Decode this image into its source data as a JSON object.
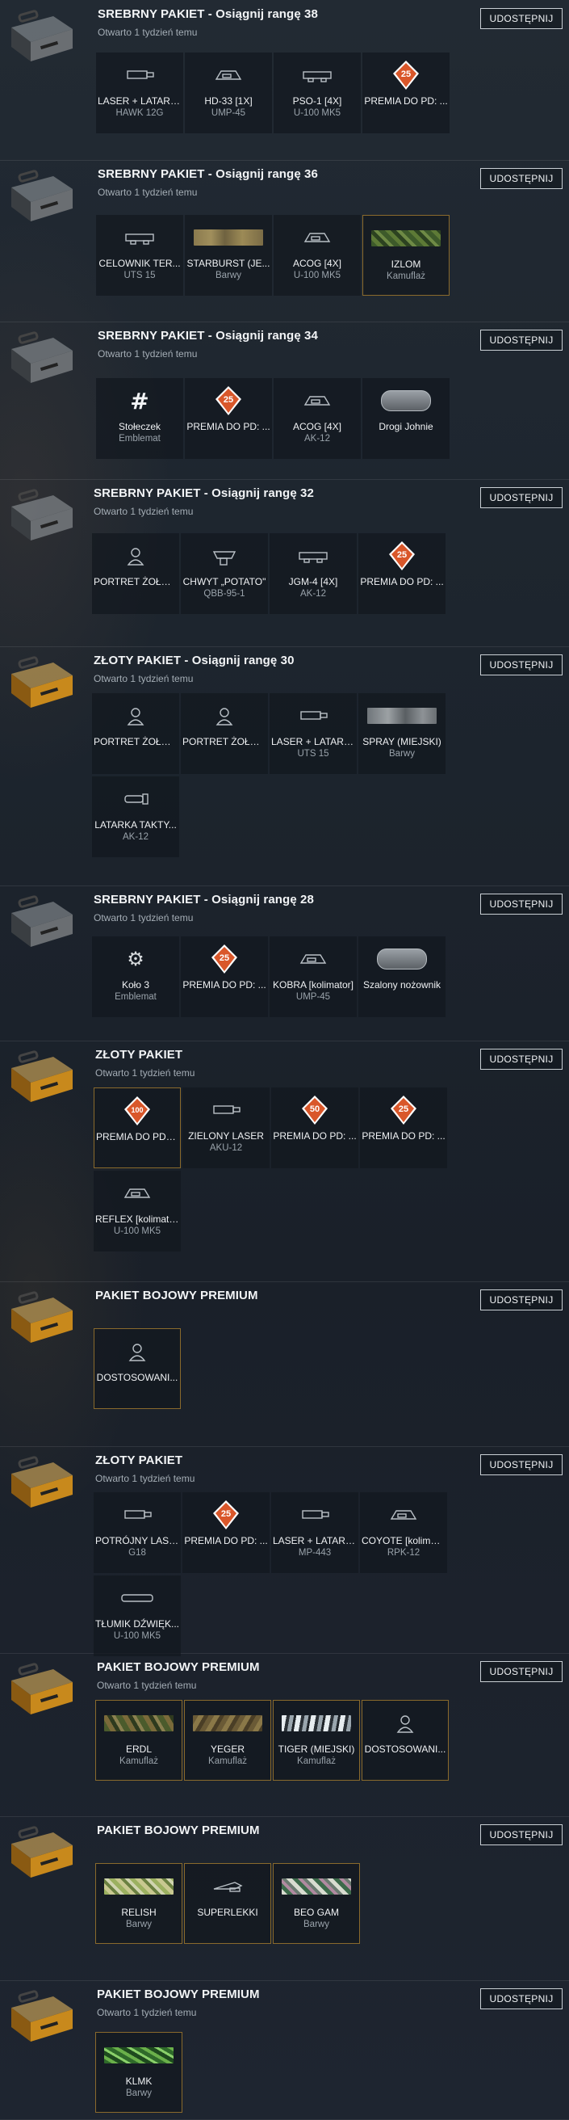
{
  "colors": {
    "accent_gold": "#8a6a2c",
    "premium_orange": "#d9572a",
    "text_muted": "#a4adb5"
  },
  "share_label": "UDOSTĘPNIJ",
  "packs": [
    {
      "title": "SREBRNY PAKIET - Osiągnij rangę 38",
      "subtitle": "Otwarto 1 tydzień temu",
      "case": "silver",
      "items": [
        {
          "name": "LASER + LATARKA",
          "desc": "HAWK 12G",
          "icon": "laser-icon"
        },
        {
          "name": "HD-33 [1X]",
          "desc": "UMP-45",
          "icon": "sight-icon"
        },
        {
          "name": "PSO-1 [4X]",
          "desc": "U-100 MK5",
          "icon": "scope-icon"
        },
        {
          "name": "PREMIA DO PD: ...",
          "desc": "",
          "icon": "xp-boost-icon",
          "badge": "25"
        }
      ]
    },
    {
      "title": "SREBRNY PAKIET - Osiągnij rangę 36",
      "subtitle": "Otwarto 1 tydzień temu",
      "case": "silver",
      "items": [
        {
          "name": "CELOWNIK TER...",
          "desc": "UTS 15",
          "icon": "scope-icon"
        },
        {
          "name": "STARBURST (JE...",
          "desc": "Barwy",
          "icon": "camo-icon",
          "camo": "desert"
        },
        {
          "name": "ACOG [4X]",
          "desc": "U-100 MK5",
          "icon": "sight-icon"
        },
        {
          "name": "IZLOM",
          "desc": "Kamuflaż",
          "icon": "camo-icon",
          "camo": "green",
          "highlight": true
        }
      ]
    },
    {
      "title": "SREBRNY PAKIET - Osiągnij rangę 34",
      "subtitle": "Otwarto 1 tydzień temu",
      "case": "silver",
      "items": [
        {
          "name": "Stołeczek",
          "desc": "Emblemat",
          "icon": "hash-emblem-icon"
        },
        {
          "name": "PREMIA DO PD: ...",
          "desc": "",
          "icon": "xp-boost-icon",
          "badge": "25"
        },
        {
          "name": "ACOG [4X]",
          "desc": "AK-12",
          "icon": "sight-icon"
        },
        {
          "name": "Drogi Johnie",
          "desc": "",
          "icon": "dogtag-icon"
        }
      ]
    },
    {
      "title": "SREBRNY PAKIET - Osiągnij rangę 32",
      "subtitle": "Otwarto 1 tydzień temu",
      "case": "silver",
      "items": [
        {
          "name": "PORTRET ŻOŁNI...",
          "desc": "",
          "icon": "soldier-icon"
        },
        {
          "name": "CHWYT „POTATO\"",
          "desc": "QBB-95-1",
          "icon": "grip-icon"
        },
        {
          "name": "JGM-4 [4X]",
          "desc": "AK-12",
          "icon": "scope-icon"
        },
        {
          "name": "PREMIA DO PD: ...",
          "desc": "",
          "icon": "xp-boost-icon",
          "badge": "25"
        }
      ]
    },
    {
      "title": "ZŁOTY PAKIET - Osiągnij rangę 30",
      "subtitle": "Otwarto 1 tydzień temu",
      "case": "gold",
      "items": [
        {
          "name": "PORTRET ŻOŁNI...",
          "desc": "",
          "icon": "soldier-icon"
        },
        {
          "name": "PORTRET ŻOŁNI...",
          "desc": "",
          "icon": "soldier-icon"
        },
        {
          "name": "LASER + LATARKA",
          "desc": "UTS 15",
          "icon": "laser-icon"
        },
        {
          "name": "SPRAY (MIEJSKI)",
          "desc": "Barwy",
          "icon": "camo-icon",
          "camo": "urban"
        },
        {
          "name": "LATARKA TAKTY...",
          "desc": "AK-12",
          "icon": "flashlight-icon"
        }
      ]
    },
    {
      "title": "SREBRNY PAKIET - Osiągnij rangę 28",
      "subtitle": "Otwarto 1 tydzień temu",
      "case": "silver",
      "items": [
        {
          "name": "Koło 3",
          "desc": "Emblemat",
          "icon": "gear-emblem-icon"
        },
        {
          "name": "PREMIA DO PD: ...",
          "desc": "",
          "icon": "xp-boost-icon",
          "badge": "25"
        },
        {
          "name": "KOBRA [kolimator]",
          "desc": "UMP-45",
          "icon": "sight-icon"
        },
        {
          "name": "Szalony nożownik",
          "desc": "",
          "icon": "dogtag-icon"
        }
      ]
    },
    {
      "title": "ZŁOTY PAKIET",
      "subtitle": "Otwarto 1 tydzień temu",
      "case": "gold",
      "items": [
        {
          "name": "PREMIA DO PD: ...",
          "desc": "",
          "icon": "xp-boost-icon",
          "badge": "100",
          "highlight": true
        },
        {
          "name": "ZIELONY LASER",
          "desc": "AKU-12",
          "icon": "laser-icon"
        },
        {
          "name": "PREMIA DO PD: ...",
          "desc": "",
          "icon": "xp-boost-icon",
          "badge": "50"
        },
        {
          "name": "PREMIA DO PD: ...",
          "desc": "",
          "icon": "xp-boost-icon",
          "badge": "25"
        },
        {
          "name": "REFLEX [kolimator]",
          "desc": "U-100 MK5",
          "icon": "sight-icon"
        }
      ]
    },
    {
      "title": "PAKIET BOJOWY PREMIUM",
      "subtitle": "",
      "case": "gold",
      "items": [
        {
          "name": "DOSTOSOWANI...",
          "desc": "",
          "icon": "soldier-icon",
          "highlight": true
        }
      ]
    },
    {
      "title": "ZŁOTY PAKIET",
      "subtitle": "Otwarto 1 tydzień temu",
      "case": "gold",
      "items": [
        {
          "name": "POTRÓJNY LASER",
          "desc": "G18",
          "icon": "laser-icon"
        },
        {
          "name": "PREMIA DO PD: ...",
          "desc": "",
          "icon": "xp-boost-icon",
          "badge": "25"
        },
        {
          "name": "LASER + LATARKA",
          "desc": "MP-443",
          "icon": "laser-icon"
        },
        {
          "name": "COYOTE [kolimator]",
          "desc": "RPK-12",
          "icon": "sight-icon"
        },
        {
          "name": "TŁUMIK DŹWIĘK...",
          "desc": "U-100 MK5",
          "icon": "suppressor-icon"
        }
      ]
    },
    {
      "title": "PAKIET BOJOWY PREMIUM",
      "subtitle": "Otwarto 1 tydzień temu",
      "case": "gold",
      "items": [
        {
          "name": "ERDL",
          "desc": "Kamuflaż",
          "icon": "camo-icon",
          "camo": "woodland",
          "highlight": true
        },
        {
          "name": "YEGER",
          "desc": "Kamuflaż",
          "icon": "camo-icon",
          "camo": "brown",
          "highlight": true
        },
        {
          "name": "TIGER (MIEJSKI)",
          "desc": "Kamuflaż",
          "icon": "camo-icon",
          "camo": "tiger",
          "highlight": true
        },
        {
          "name": "DOSTOSOWANI...",
          "desc": "",
          "icon": "soldier-icon",
          "highlight": true
        }
      ]
    },
    {
      "title": "PAKIET BOJOWY PREMIUM",
      "subtitle": "",
      "case": "gold",
      "items": [
        {
          "name": "RELISH",
          "desc": "Barwy",
          "icon": "camo-icon",
          "camo": "relish",
          "highlight": true
        },
        {
          "name": "SUPERLEKKI",
          "desc": "",
          "icon": "knife-icon",
          "highlight": true
        },
        {
          "name": "BEO GAM",
          "desc": "Barwy",
          "icon": "camo-icon",
          "camo": "beo",
          "highlight": true
        }
      ]
    },
    {
      "title": "PAKIET BOJOWY PREMIUM",
      "subtitle": "Otwarto 1 tydzień temu",
      "case": "gold",
      "items": [
        {
          "name": "KLMK",
          "desc": "Barwy",
          "icon": "camo-icon",
          "camo": "klmk",
          "highlight": true
        }
      ]
    }
  ]
}
